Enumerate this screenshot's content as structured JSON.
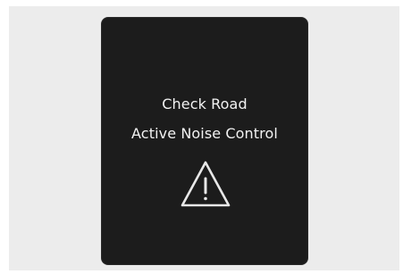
{
  "warning_display": {
    "line1": "Check Road",
    "line2": "Active Noise Control",
    "icon": "warning-triangle-icon",
    "colors": {
      "screen_background": "#1c1c1c",
      "text": "#f2f2f2",
      "page_background": "#ececec"
    }
  }
}
